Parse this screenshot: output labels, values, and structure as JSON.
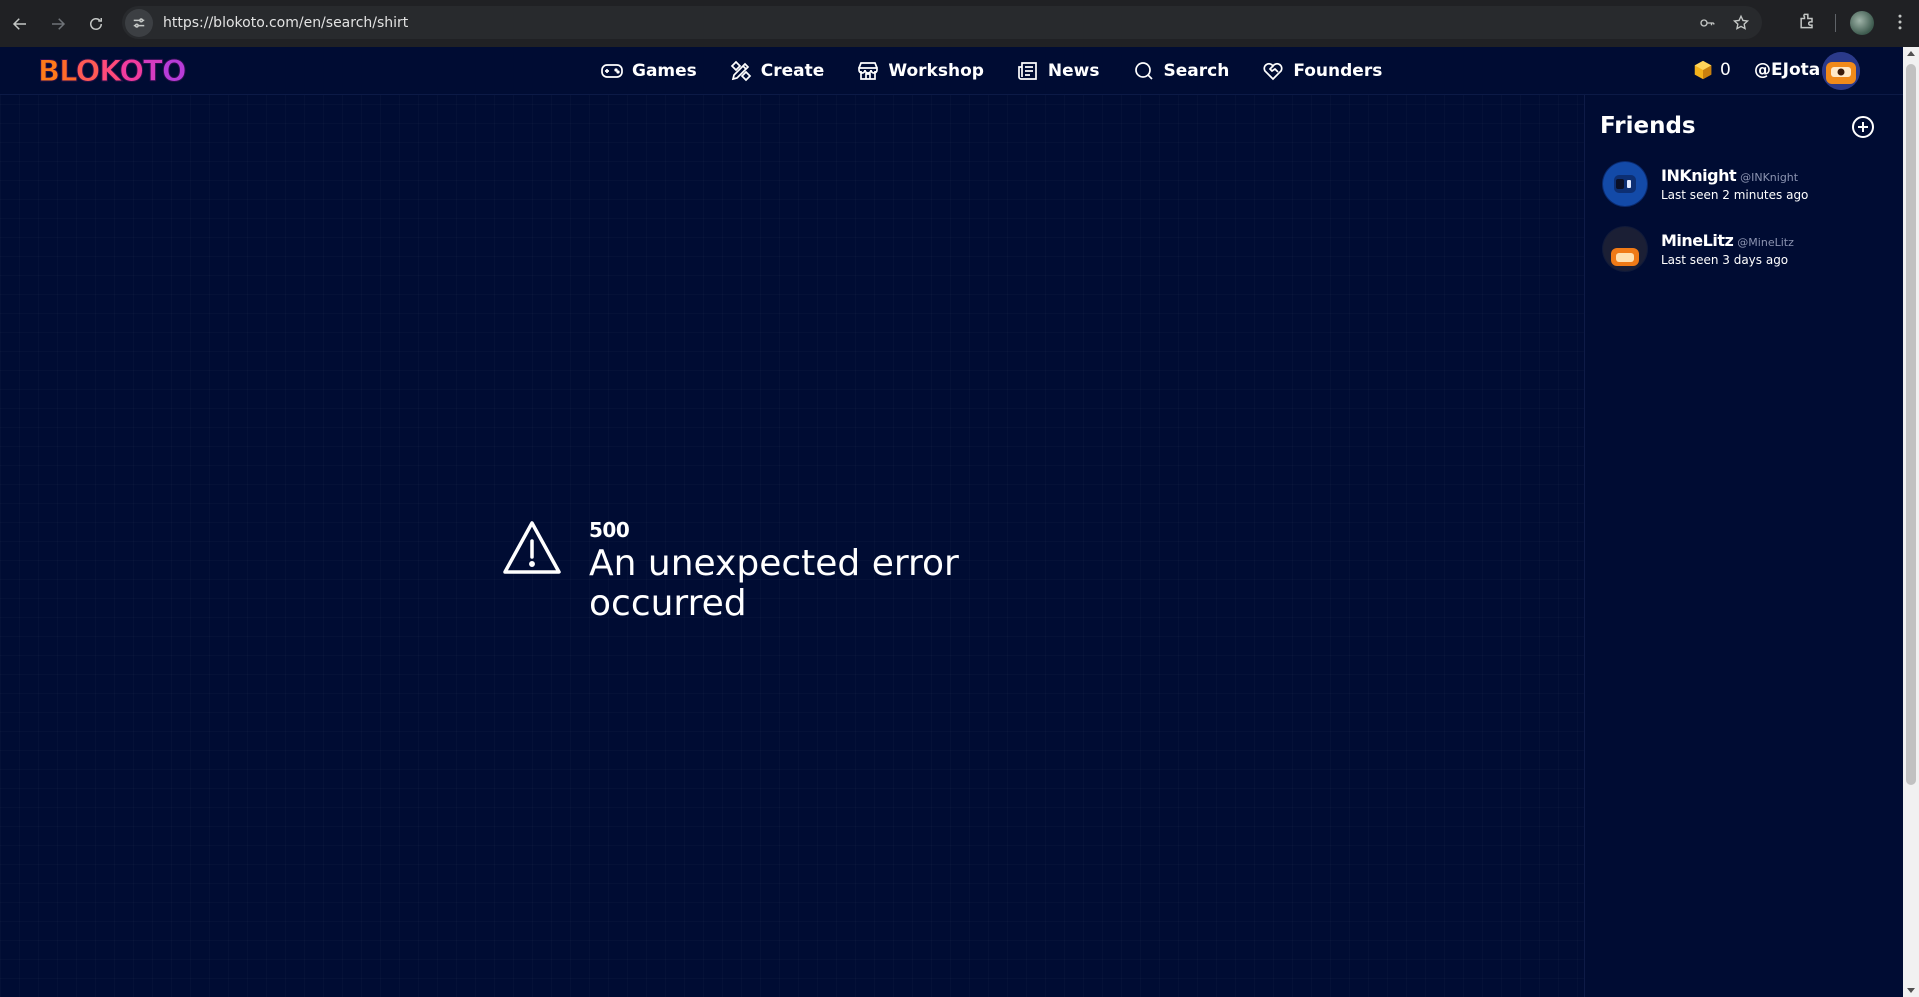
{
  "browser": {
    "url": "https://blokoto.com/en/search/shirt",
    "icons": [
      "back-icon",
      "forward-icon",
      "reload-icon",
      "site-settings-icon",
      "password-key-icon",
      "bookmark-star-icon",
      "extensions-icon",
      "profile-avatar",
      "more-menu-icon"
    ]
  },
  "header": {
    "logo_letters": [
      "B",
      "L",
      "O",
      "K",
      "O",
      "T",
      "O"
    ],
    "logo_colors": [
      "#ff7a1a",
      "#ff6a2a",
      "#ff5a55",
      "#ff4a7a",
      "#f03c9e",
      "#d53cc0",
      "#b73cd8"
    ],
    "nav": [
      {
        "label": "Games",
        "icon": "gamepad-icon"
      },
      {
        "label": "Create",
        "icon": "create-tools-icon"
      },
      {
        "label": "Workshop",
        "icon": "store-icon"
      },
      {
        "label": "News",
        "icon": "newspaper-icon"
      },
      {
        "label": "Search",
        "icon": "search-icon"
      },
      {
        "label": "Founders",
        "icon": "heart-handshake-icon"
      }
    ],
    "currency_amount": "0",
    "username": "@EJota"
  },
  "error": {
    "code": "500",
    "message": "An unexpected error occurred"
  },
  "friends": {
    "title": "Friends",
    "items": [
      {
        "name": "INKnight",
        "handle": "@INKnight",
        "last_seen": "Last seen 2 minutes ago"
      },
      {
        "name": "MineLitz",
        "handle": "@MineLitz",
        "last_seen": "Last seen 3 days ago"
      }
    ]
  },
  "colors": {
    "background": "#000c33",
    "chrome": "#202124",
    "text": "#ffffff",
    "muted": "#8b93b0"
  }
}
